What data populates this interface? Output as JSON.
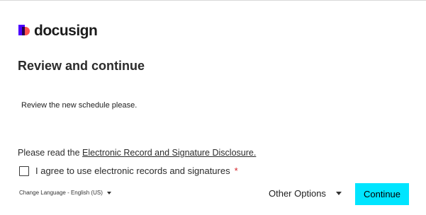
{
  "brand": {
    "name": "docusign"
  },
  "page": {
    "title": "Review and continue",
    "message": "Review the new schedule please."
  },
  "disclosure": {
    "prefix": "Please read the ",
    "link_text": "Electronic Record and Signature Disclosure."
  },
  "agreement": {
    "label": "I agree to use electronic records and signatures",
    "required_marker": "*",
    "checked": false
  },
  "footer": {
    "language": "Change Language - English (US)",
    "other_options": "Other Options",
    "continue_label": "Continue"
  },
  "colors": {
    "continue_button": "#00e5ff",
    "required": "#d4242a",
    "logo_purple": "#4c00ff",
    "logo_pink": "#ff5252"
  }
}
